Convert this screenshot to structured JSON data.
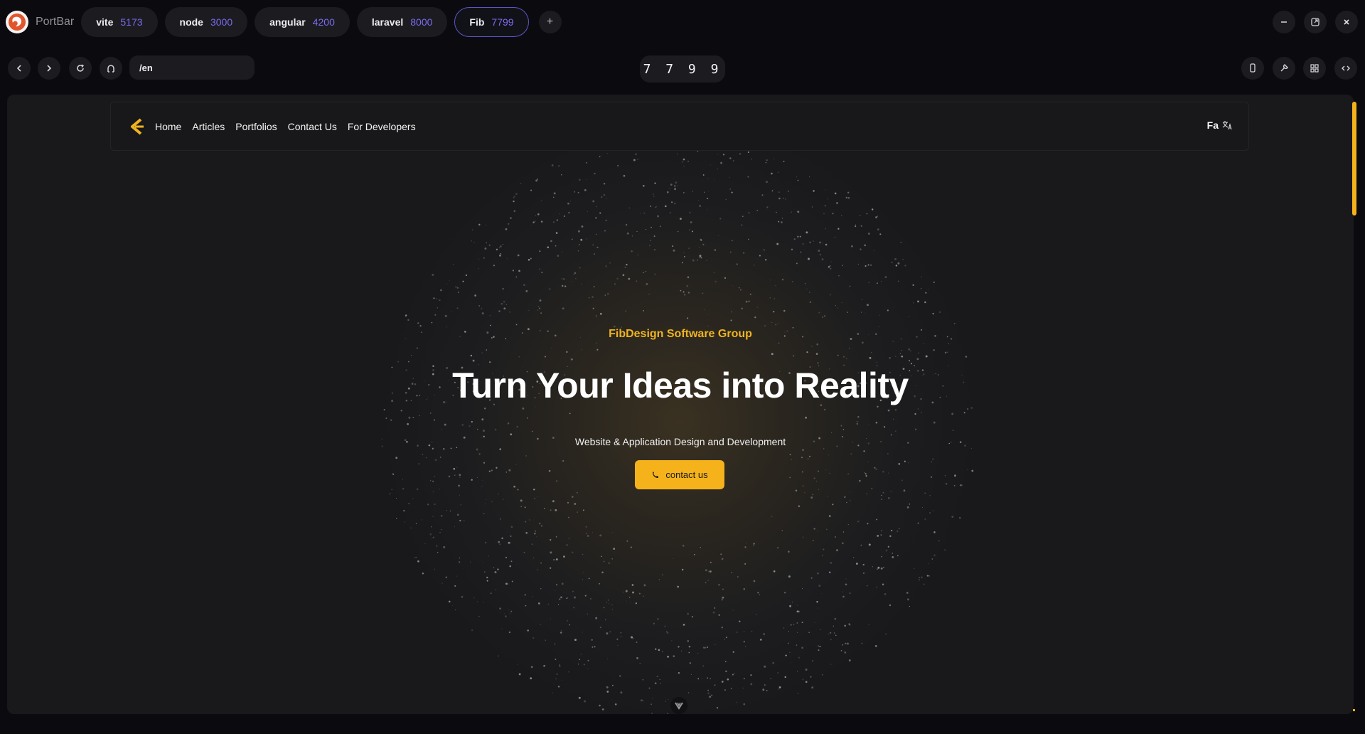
{
  "app": {
    "name": "PortBar"
  },
  "tabs": [
    {
      "name": "vite",
      "port": "5173"
    },
    {
      "name": "node",
      "port": "3000"
    },
    {
      "name": "angular",
      "port": "4200"
    },
    {
      "name": "laravel",
      "port": "8000"
    },
    {
      "name": "Fib",
      "port": "7799",
      "active": true
    }
  ],
  "add_tab_label": "+",
  "address": {
    "path": "/en"
  },
  "port_display": "7799",
  "site": {
    "nav": [
      "Home",
      "Articles",
      "Portfolios",
      "Contact Us",
      "For Developers"
    ],
    "lang": "Fa",
    "hero": {
      "tag": "FibDesign Software Group",
      "title": "Turn Your Ideas into Reality",
      "subtitle": "Website & Application Design and Development",
      "button": "contact us"
    }
  },
  "colors": {
    "accent": "#f5b21b",
    "port_number": "#7a6cf0",
    "active_tab_border": "#5c55c8",
    "page_bg": "#0b0b0f"
  },
  "icons": {
    "nav": [
      "chevron-left-icon",
      "chevron-right-icon",
      "reload-icon",
      "home-icon"
    ],
    "tools": [
      "mobile-icon",
      "tools-icon",
      "grid-icon",
      "code-icon"
    ],
    "window": [
      "minimize-icon",
      "maximize-icon",
      "close-icon"
    ]
  }
}
